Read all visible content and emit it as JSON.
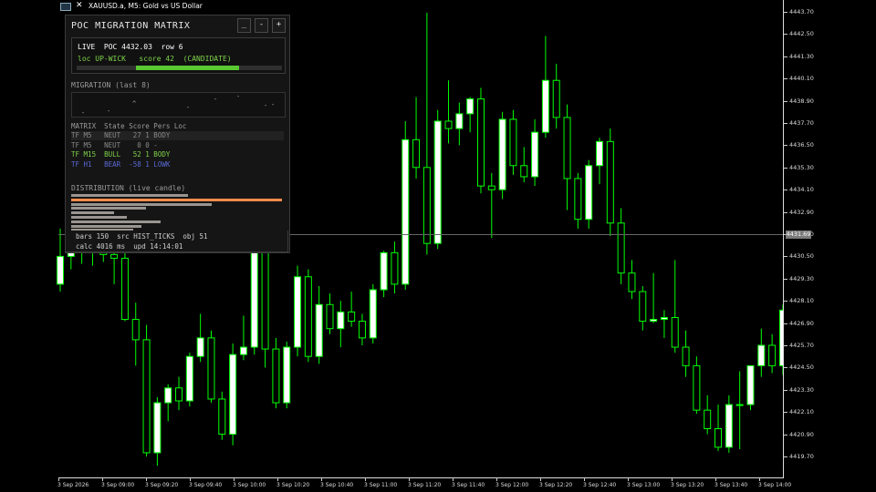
{
  "chart_header": {
    "title": "XAUUSD.a, M5:  Gold vs US Dollar",
    "icon_left": "chart-window-icon",
    "icon_right": "close-icon"
  },
  "price_axis": {
    "labels": [
      "4443.70",
      "4442.50",
      "4441.30",
      "4440.10",
      "4438.90",
      "4437.70",
      "4436.50",
      "4435.30",
      "4434.10",
      "4432.90",
      "4431.70",
      "4430.50",
      "4429.30",
      "4428.10",
      "4426.90",
      "4425.70",
      "4424.50",
      "4423.30",
      "4422.10",
      "4420.90",
      "4419.70"
    ],
    "current_price": "4431.69"
  },
  "time_axis": {
    "labels": [
      "3 Sep 2026",
      "3 Sep 09:00",
      "3 Sep 09:20",
      "3 Sep 09:40",
      "3 Sep 10:00",
      "3 Sep 10:20",
      "3 Sep 10:40",
      "3 Sep 11:00",
      "3 Sep 11:20",
      "3 Sep 11:40",
      "3 Sep 12:00",
      "3 Sep 12:20",
      "3 Sep 12:40",
      "3 Sep 13:00",
      "3 Sep 13:20",
      "3 Sep 13:40",
      "3 Sep 14:00"
    ]
  },
  "colors": {
    "candle_bull_body": "#ffffff",
    "candle_outline": "#00ff00",
    "panel_bg": "#151515",
    "bull_text": "#7fd44a",
    "bear_text": "#5a6ad8",
    "poc_bar": "#f08a4b"
  },
  "panel": {
    "title": "POC MIGRATION MATRIX",
    "buttons": {
      "minimize": "_",
      "collapse": "-",
      "expand": "+"
    },
    "live": {
      "line": "LIVE  POC 4432.03  row 6",
      "loc_line": "loc UP-WICK   score 42  (CANDIDATE)",
      "score_fraction": 0.42
    },
    "migration": {
      "title": "MIGRATION (last 8)",
      "marks": [
        "^",
        "-",
        "-",
        "-",
        "-",
        "-",
        "-",
        "-"
      ]
    },
    "matrix": {
      "header": "MATRIX  State Score Pers Loc",
      "rows": [
        {
          "text": "TF M5   NEUT   27 1 BODY",
          "color": "#8a8a8a"
        },
        {
          "text": "TF M5   NEUT    0 0 -",
          "color": "#8a8a8a"
        },
        {
          "text": "TF M15  BULL   52 1 BODY",
          "color": "#7fd44a"
        },
        {
          "text": "TF H1   BEAR  -58 1 LOWK",
          "color": "#5a6ad8"
        }
      ]
    },
    "distribution": {
      "title": "DISTRIBUTION (live candle)",
      "bars": [
        0.55,
        0.99,
        0.66,
        0.35,
        0.2,
        0.26,
        0.42,
        0.33,
        0.29
      ],
      "poc_index": 1
    },
    "footer": {
      "line1": "bars 150  src HIST_TICKS  obj 51",
      "line2": "calc 4016 ms  upd 14:14:01"
    }
  },
  "chart_data": {
    "type": "candlestick",
    "symbol": "XAUUSD.a",
    "timeframe": "M5",
    "ylim": [
      4419.0,
      4444.5
    ],
    "current_price": 4431.69,
    "candles": [
      {
        "o": 4429.0,
        "h": 4432.0,
        "l": 4428.6,
        "c": 4430.5
      },
      {
        "o": 4430.5,
        "h": 4432.2,
        "l": 4429.8,
        "c": 4431.0
      },
      {
        "o": 4431.0,
        "h": 4432.0,
        "l": 4430.1,
        "c": 4430.8
      },
      {
        "o": 4430.8,
        "h": 4431.9,
        "l": 4430.0,
        "c": 4430.9
      },
      {
        "o": 4430.8,
        "h": 4431.5,
        "l": 4430.2,
        "c": 4430.6
      },
      {
        "o": 4430.6,
        "h": 4431.2,
        "l": 4429.0,
        "c": 4430.4
      },
      {
        "o": 4430.4,
        "h": 4430.9,
        "l": 4427.0,
        "c": 4427.1
      },
      {
        "o": 4427.1,
        "h": 4428.0,
        "l": 4424.6,
        "c": 4426.0
      },
      {
        "o": 4426.0,
        "h": 4426.8,
        "l": 4419.7,
        "c": 4419.9
      },
      {
        "o": 4419.9,
        "h": 4422.9,
        "l": 4419.2,
        "c": 4422.6
      },
      {
        "o": 4422.6,
        "h": 4423.6,
        "l": 4421.6,
        "c": 4423.4
      },
      {
        "o": 4423.4,
        "h": 4424.0,
        "l": 4422.2,
        "c": 4422.7
      },
      {
        "o": 4422.7,
        "h": 4425.3,
        "l": 4422.4,
        "c": 4425.1
      },
      {
        "o": 4425.1,
        "h": 4427.4,
        "l": 4424.8,
        "c": 4426.1
      },
      {
        "o": 4426.1,
        "h": 4426.5,
        "l": 4422.6,
        "c": 4422.8
      },
      {
        "o": 4422.8,
        "h": 4423.2,
        "l": 4420.6,
        "c": 4420.9
      },
      {
        "o": 4420.9,
        "h": 4425.8,
        "l": 4420.3,
        "c": 4425.2
      },
      {
        "o": 4425.2,
        "h": 4427.3,
        "l": 4424.9,
        "c": 4425.6
      },
      {
        "o": 4425.6,
        "h": 4431.3,
        "l": 4425.2,
        "c": 4430.9
      },
      {
        "o": 4430.9,
        "h": 4432.3,
        "l": 4424.5,
        "c": 4425.5
      },
      {
        "o": 4425.5,
        "h": 4426.1,
        "l": 4422.3,
        "c": 4422.6
      },
      {
        "o": 4422.6,
        "h": 4425.9,
        "l": 4422.3,
        "c": 4425.6
      },
      {
        "o": 4425.6,
        "h": 4430.0,
        "l": 4425.1,
        "c": 4429.4
      },
      {
        "o": 4429.4,
        "h": 4429.8,
        "l": 4424.8,
        "c": 4425.1
      },
      {
        "o": 4425.1,
        "h": 4428.9,
        "l": 4424.7,
        "c": 4427.9
      },
      {
        "o": 4427.9,
        "h": 4428.5,
        "l": 4426.3,
        "c": 4426.6
      },
      {
        "o": 4426.6,
        "h": 4428.1,
        "l": 4425.6,
        "c": 4427.5
      },
      {
        "o": 4427.5,
        "h": 4428.6,
        "l": 4426.7,
        "c": 4427.0
      },
      {
        "o": 4427.0,
        "h": 4427.4,
        "l": 4425.7,
        "c": 4426.1
      },
      {
        "o": 4426.1,
        "h": 4429.0,
        "l": 4425.8,
        "c": 4428.7
      },
      {
        "o": 4428.7,
        "h": 4430.8,
        "l": 4428.3,
        "c": 4430.7
      },
      {
        "o": 4430.7,
        "h": 4431.3,
        "l": 4428.5,
        "c": 4429.0
      },
      {
        "o": 4429.0,
        "h": 4437.8,
        "l": 4428.7,
        "c": 4436.8
      },
      {
        "o": 4436.8,
        "h": 4439.1,
        "l": 4434.7,
        "c": 4435.3
      },
      {
        "o": 4435.3,
        "h": 4443.9,
        "l": 4430.6,
        "c": 4431.2
      },
      {
        "o": 4431.2,
        "h": 4438.4,
        "l": 4430.9,
        "c": 4437.8
      },
      {
        "o": 4437.8,
        "h": 4440.0,
        "l": 4436.6,
        "c": 4437.4
      },
      {
        "o": 4437.4,
        "h": 4438.8,
        "l": 4436.5,
        "c": 4438.2
      },
      {
        "o": 4438.2,
        "h": 4439.1,
        "l": 4437.2,
        "c": 4439.0
      },
      {
        "o": 4439.0,
        "h": 4439.6,
        "l": 4433.9,
        "c": 4434.3
      },
      {
        "o": 4434.3,
        "h": 4435.0,
        "l": 4431.5,
        "c": 4434.1
      },
      {
        "o": 4434.1,
        "h": 4438.3,
        "l": 4433.6,
        "c": 4437.9
      },
      {
        "o": 4437.9,
        "h": 4438.4,
        "l": 4434.9,
        "c": 4435.4
      },
      {
        "o": 4435.4,
        "h": 4436.4,
        "l": 4434.5,
        "c": 4434.8
      },
      {
        "o": 4434.8,
        "h": 4437.9,
        "l": 4434.3,
        "c": 4437.2
      },
      {
        "o": 4437.2,
        "h": 4442.4,
        "l": 4436.9,
        "c": 4440.0
      },
      {
        "o": 4440.0,
        "h": 4440.9,
        "l": 4437.4,
        "c": 4438.0
      },
      {
        "o": 4438.0,
        "h": 4438.7,
        "l": 4433.0,
        "c": 4434.7
      },
      {
        "o": 4434.7,
        "h": 4435.0,
        "l": 4432.0,
        "c": 4432.5
      },
      {
        "o": 4432.5,
        "h": 4435.7,
        "l": 4432.0,
        "c": 4435.4
      },
      {
        "o": 4435.4,
        "h": 4436.9,
        "l": 4434.4,
        "c": 4436.7
      },
      {
        "o": 4436.7,
        "h": 4437.4,
        "l": 4431.6,
        "c": 4432.3
      },
      {
        "o": 4432.3,
        "h": 4433.1,
        "l": 4429.0,
        "c": 4429.6
      },
      {
        "o": 4429.6,
        "h": 4430.3,
        "l": 4428.2,
        "c": 4428.6
      },
      {
        "o": 4428.6,
        "h": 4428.9,
        "l": 4426.5,
        "c": 4427.0
      },
      {
        "o": 4427.0,
        "h": 4429.6,
        "l": 4426.9,
        "c": 4427.1
      },
      {
        "o": 4427.1,
        "h": 4427.6,
        "l": 4426.1,
        "c": 4427.2
      },
      {
        "o": 4427.2,
        "h": 4430.3,
        "l": 4425.3,
        "c": 4425.6
      },
      {
        "o": 4425.6,
        "h": 4426.5,
        "l": 4424.0,
        "c": 4424.6
      },
      {
        "o": 4424.6,
        "h": 4425.1,
        "l": 4422.0,
        "c": 4422.2
      },
      {
        "o": 4422.2,
        "h": 4423.0,
        "l": 4420.9,
        "c": 4421.2
      },
      {
        "o": 4421.2,
        "h": 4422.5,
        "l": 4420.0,
        "c": 4420.2
      },
      {
        "o": 4420.2,
        "h": 4423.0,
        "l": 4419.9,
        "c": 4422.5
      },
      {
        "o": 4422.5,
        "h": 4424.3,
        "l": 4420.1,
        "c": 4422.5
      },
      {
        "o": 4422.5,
        "h": 4424.6,
        "l": 4422.2,
        "c": 4424.6
      },
      {
        "o": 4424.6,
        "h": 4426.6,
        "l": 4424.0,
        "c": 4425.7
      },
      {
        "o": 4425.7,
        "h": 4426.3,
        "l": 4424.2,
        "c": 4424.6
      },
      {
        "o": 4424.6,
        "h": 4427.9,
        "l": 4424.1,
        "c": 4427.6
      },
      {
        "o": 4427.6,
        "h": 4428.2,
        "l": 4426.7,
        "c": 4428.0
      },
      {
        "o": 4428.0,
        "h": 4428.7,
        "l": 4426.4,
        "c": 4426.7
      },
      {
        "o": 4426.7,
        "h": 4429.9,
        "l": 4424.4,
        "c": 4428.8
      },
      {
        "o": 4428.8,
        "h": 4431.3,
        "l": 4427.9,
        "c": 4430.6
      },
      {
        "o": 4430.6,
        "h": 4431.9,
        "l": 4429.2,
        "c": 4431.6
      }
    ]
  }
}
